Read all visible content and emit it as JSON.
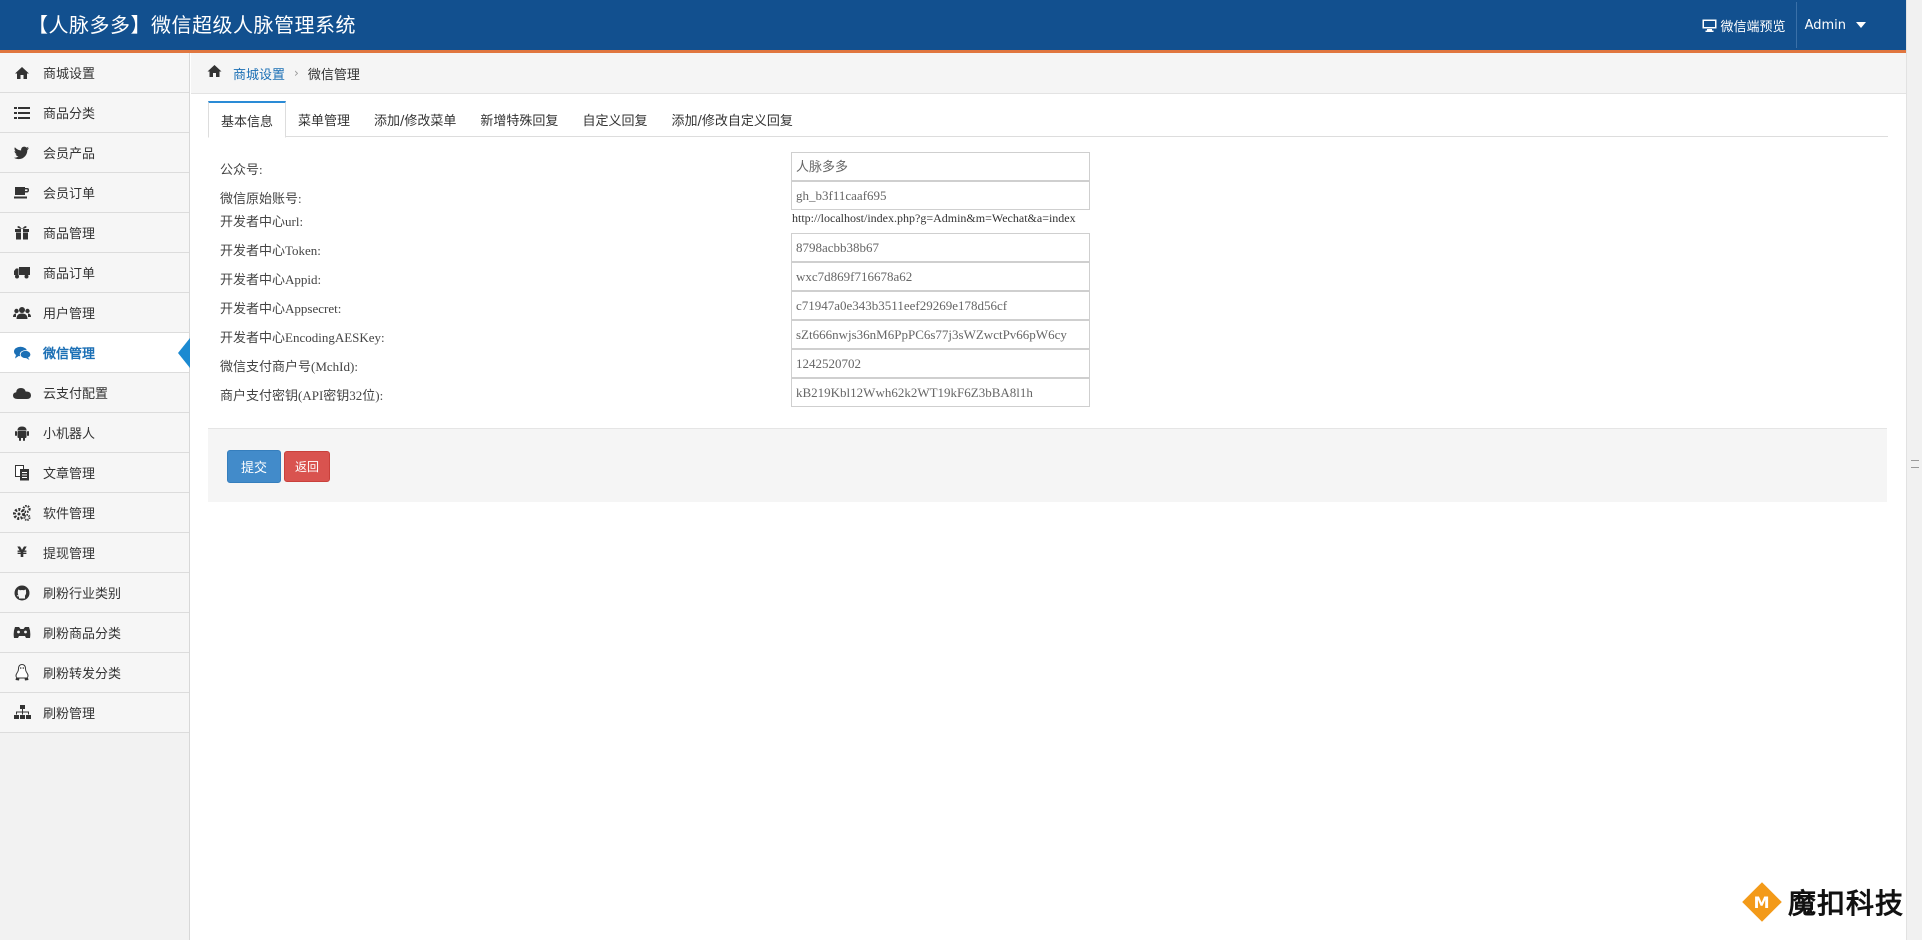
{
  "header": {
    "title": "【人脉多多】微信超级人脉管理系统",
    "preview_label": "微信端预览",
    "user_label": "Admin"
  },
  "sidebar": {
    "items": [
      {
        "label": "商城设置",
        "icon": "home-icon"
      },
      {
        "label": "商品分类",
        "icon": "list-icon"
      },
      {
        "label": "会员产品",
        "icon": "twitter-icon"
      },
      {
        "label": "会员订单",
        "icon": "coffee-cup-icon"
      },
      {
        "label": "商品管理",
        "icon": "gift-icon"
      },
      {
        "label": "商品订单",
        "icon": "truck-icon"
      },
      {
        "label": "用户管理",
        "icon": "users-icon"
      },
      {
        "label": "微信管理",
        "icon": "chat-bubbles-icon",
        "active": true
      },
      {
        "label": "云支付配置",
        "icon": "cloud-icon"
      },
      {
        "label": "小机器人",
        "icon": "android-icon"
      },
      {
        "label": "文章管理",
        "icon": "files-icon"
      },
      {
        "label": "软件管理",
        "icon": "gears-icon"
      },
      {
        "label": "提现管理",
        "icon": "yen-icon"
      },
      {
        "label": "刷粉行业类别",
        "icon": "github-icon"
      },
      {
        "label": "刷粉商品分类",
        "icon": "gamepad-icon"
      },
      {
        "label": "刷粉转发分类",
        "icon": "linux-icon"
      },
      {
        "label": "刷粉管理",
        "icon": "sitemap-icon"
      }
    ]
  },
  "breadcrumb": {
    "parent": "商城设置",
    "current": "微信管理"
  },
  "tabs": [
    {
      "label": "基本信息",
      "active": true
    },
    {
      "label": "菜单管理"
    },
    {
      "label": "添加/修改菜单"
    },
    {
      "label": "新增特殊回复"
    },
    {
      "label": "自定义回复"
    },
    {
      "label": "添加/修改自定义回复"
    }
  ],
  "form": {
    "fields": [
      {
        "label": "公众号:",
        "value": "人脉多多",
        "type": "input"
      },
      {
        "label": "微信原始账号:",
        "value": "gh_b3f11caaf695",
        "type": "input"
      },
      {
        "label": "开发者中心url:",
        "value": "http://localhost/index.php?g=Admin&m=Wechat&a=index",
        "type": "text"
      },
      {
        "label": "开发者中心Token:",
        "value": "8798acbb38b67",
        "type": "input"
      },
      {
        "label": "开发者中心Appid:",
        "value": "wxc7d869f716678a62",
        "type": "input"
      },
      {
        "label": "开发者中心Appsecret:",
        "value": "c71947a0e343b3511eef29269e178d56cf",
        "type": "input"
      },
      {
        "label": "开发者中心EncodingAESKey:",
        "value": "sZt666nwjs36nM6PpPC6s77j3sWZwctPv66pW6cy",
        "type": "input"
      },
      {
        "label": "微信支付商户号(MchId):",
        "value": "1242520702",
        "type": "input"
      },
      {
        "label": "商户支付密钥(API密钥32位):",
        "value": "kB219Kbl12Wwh62k2WT19kF6Z3bBA8l1h",
        "type": "input"
      }
    ]
  },
  "actions": {
    "submit_label": "提交",
    "back_label": "返回"
  },
  "watermark": {
    "logo_letter": "M",
    "text": "魔扣科技"
  },
  "colors": {
    "header_bg": "#12508f",
    "header_border": "#e0763f",
    "active_accent": "#1b8ad1",
    "submit_button": "#428bca",
    "back_button": "#d9534f"
  }
}
